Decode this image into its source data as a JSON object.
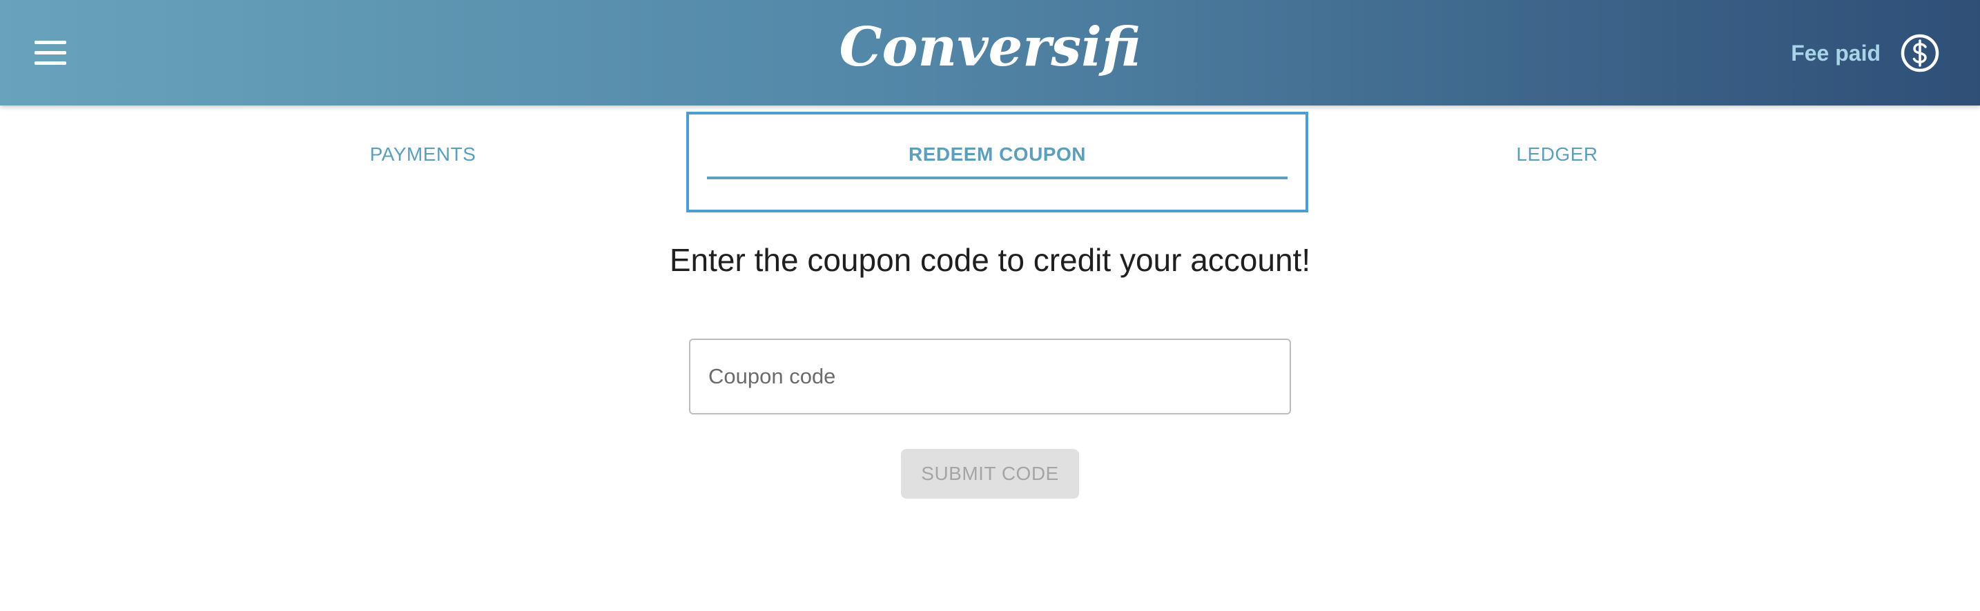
{
  "header": {
    "menu_icon": "hamburger-menu-icon",
    "logo_text": "Conversifi",
    "fee_label": "Fee paid",
    "fee_icon": "dollar-circle-icon",
    "colors": {
      "gradient_start": "#67a3ba",
      "gradient_end": "#2f4f77",
      "fee_text": "#a7d4e6"
    }
  },
  "tabs": [
    {
      "label": "PAYMENTS",
      "active": false
    },
    {
      "label": "REDEEM COUPON",
      "active": true
    },
    {
      "label": "LEDGER",
      "active": false
    }
  ],
  "main": {
    "prompt": "Enter the coupon code to credit your account!",
    "coupon_input": {
      "placeholder": "Coupon code",
      "value": ""
    },
    "submit_label": "SUBMIT CODE",
    "submit_disabled": true
  }
}
